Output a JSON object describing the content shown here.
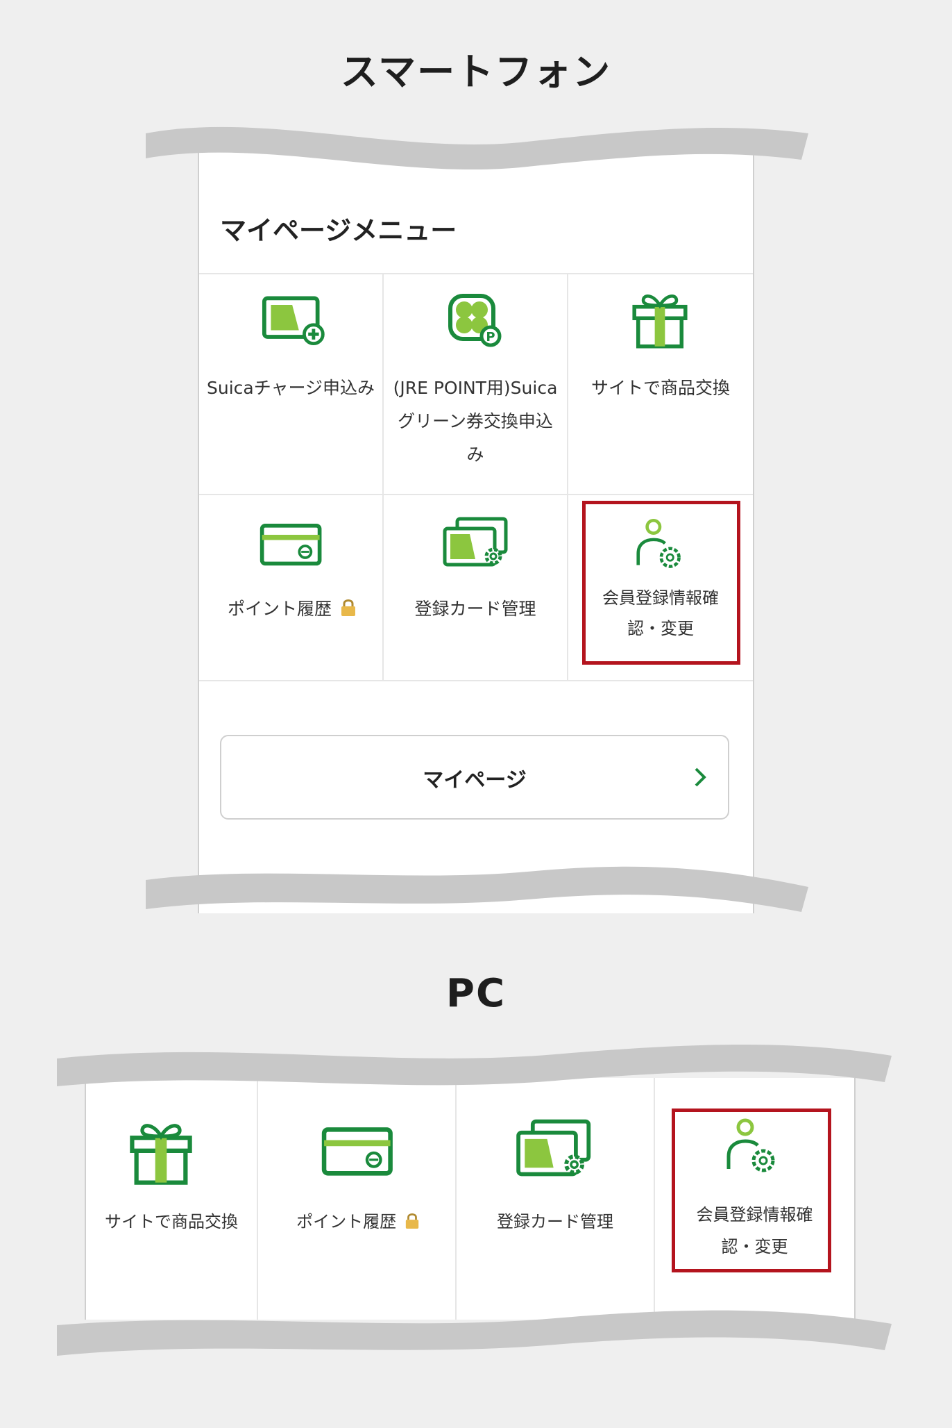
{
  "smartphone": {
    "section_title": "スマートフォン",
    "menu_title": "マイページメニュー",
    "items": [
      {
        "label": "Suicaチャージ申込み",
        "icon": "suica-charge-icon"
      },
      {
        "label": "(JRE POINT用)Suicaグリーン券交換申込み",
        "icon": "clover-point-icon"
      },
      {
        "label": "サイトで商品交換",
        "icon": "gift-icon"
      },
      {
        "label": "ポイント履歴",
        "icon": "card-point-icon",
        "badge": "lock-icon"
      },
      {
        "label": "登録カード管理",
        "icon": "card-settings-icon"
      },
      {
        "label": "会員登録情報確認・変更",
        "icon": "user-settings-icon",
        "highlighted": true
      }
    ],
    "mypage_button": "マイページ"
  },
  "pc": {
    "section_title": "PC",
    "items": [
      {
        "label": "サイトで商品交換",
        "icon": "gift-icon"
      },
      {
        "label": "ポイント履歴",
        "icon": "card-point-icon",
        "badge": "lock-icon"
      },
      {
        "label": "登録カード管理",
        "icon": "card-settings-icon"
      },
      {
        "label": "会員登録情報確認・変更",
        "icon": "user-settings-icon",
        "highlighted": true
      }
    ]
  },
  "colors": {
    "icon_green": "#1a8a3c",
    "icon_light_green": "#8cc63f",
    "highlight_red": "#b4141e",
    "background": "#efefef",
    "wave_gray": "#c8c8c8"
  }
}
